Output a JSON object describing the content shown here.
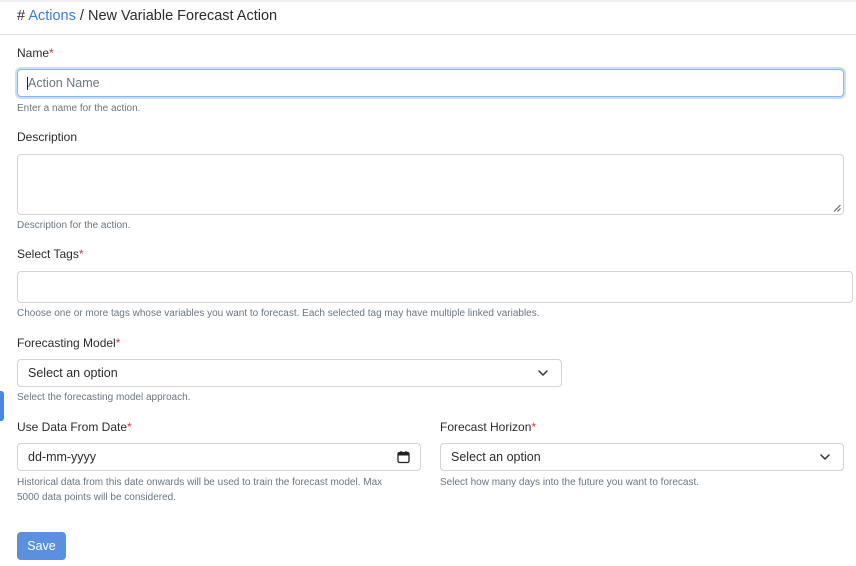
{
  "breadcrumb": {
    "hash": "#",
    "link": "Actions",
    "separator": "/",
    "current": "New Variable Forecast Action"
  },
  "form": {
    "name": {
      "label": "Name",
      "required_mark": "*",
      "placeholder": "Action Name",
      "value": "",
      "help": "Enter a name for the action."
    },
    "description": {
      "label": "Description",
      "value": "",
      "help": "Description for the action."
    },
    "tags": {
      "label": "Select Tags",
      "required_mark": "*",
      "value": "",
      "help": "Choose one or more tags whose variables you want to forecast. Each selected tag may have multiple linked variables."
    },
    "forecasting_model": {
      "label": "Forecasting Model",
      "required_mark": "*",
      "selected": "Select an option",
      "help": "Select the forecasting model approach."
    },
    "use_data_from_date": {
      "label": "Use Data From Date",
      "required_mark": "*",
      "placeholder": "dd-mm-yyyy",
      "help_line1": "Historical data from this date onwards will be used to train the forecast model. Max",
      "help_line2": "5000 data points will be considered."
    },
    "forecast_horizon": {
      "label": "Forecast Horizon",
      "required_mark": "*",
      "selected": "Select an option",
      "help": "Select how many days into the future you want to forecast."
    }
  },
  "buttons": {
    "save": "Save"
  },
  "icons": {
    "dropdown": "chevron-down-icon",
    "date": "calendar-icon",
    "resize": "resize-handle-icon"
  },
  "colors": {
    "link": "#3d7bd9",
    "required": "#dc3545",
    "primary_button": "#5b8fe0",
    "focus_border": "#86b7fe"
  }
}
